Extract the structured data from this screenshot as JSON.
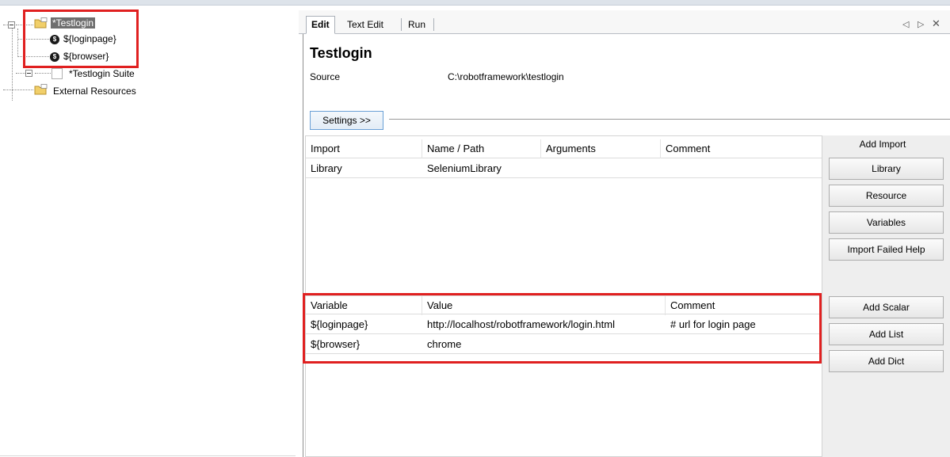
{
  "tree": {
    "root": "*Testlogin",
    "variables": [
      "${loginpage}",
      "${browser}"
    ],
    "var_icon_glyph": "$",
    "suite": "*Testlogin Suite",
    "external": "External Resources"
  },
  "tabs": {
    "edit": "Edit",
    "text_edit": "Text Edit",
    "run": "Run",
    "prev": "◁",
    "next": "▷",
    "close": "✕"
  },
  "suite": {
    "title": "Testlogin",
    "source_label": "Source",
    "source_value": "C:\\robotframework\\testlogin"
  },
  "settings_button": "Settings >>",
  "imports": {
    "headers": [
      "Import",
      "Name / Path",
      "Arguments",
      "Comment"
    ],
    "rows": [
      [
        "Library",
        "SeleniumLibrary",
        "",
        ""
      ]
    ]
  },
  "variables": {
    "headers": [
      "Variable",
      "Value",
      "Comment"
    ],
    "rows": [
      [
        "${loginpage}",
        "http://localhost/robotframework/login.html",
        "# url for login page"
      ],
      [
        "${browser}",
        "chrome",
        ""
      ]
    ]
  },
  "side_buttons": {
    "add_import_title": "Add Import",
    "library": "Library",
    "resource": "Resource",
    "variables": "Variables",
    "import_failed_help": "Import Failed Help",
    "add_scalar": "Add Scalar",
    "add_list": "Add List",
    "add_dict": "Add Dict"
  },
  "colors": {
    "highlight_box": "#e02020",
    "selected_node": "#6e6e6e",
    "settings_border": "#6aa0d6"
  }
}
